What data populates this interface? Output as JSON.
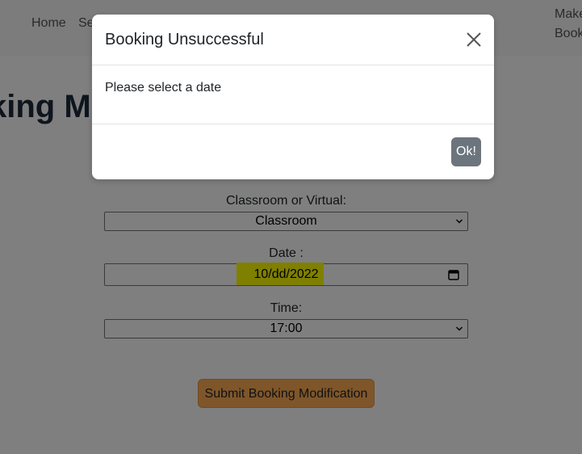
{
  "nav": {
    "home": "Home",
    "second": "Se",
    "right_line1": "Make",
    "right_line2": "Book"
  },
  "page": {
    "heading": "king Mo                             ted be"
  },
  "form": {
    "mode_label": "Classroom or Virtual:",
    "mode_value": "Classroom",
    "date_label": "Date :",
    "date_value": "10/dd/2022",
    "time_label": "Time:",
    "time_value": "17:00",
    "submit_label": "Submit Booking Modification"
  },
  "modal": {
    "title": "Booking Unsuccessful",
    "message": "Please select a date",
    "ok_label": "Ok!"
  },
  "colors": {
    "submit_button": "#ffad55",
    "ok_button": "#6c757d",
    "date_highlight": "#ffff00"
  },
  "icons": {
    "close": "close-icon",
    "dropdown": "chevron-down-icon",
    "calendar": "calendar-icon"
  }
}
